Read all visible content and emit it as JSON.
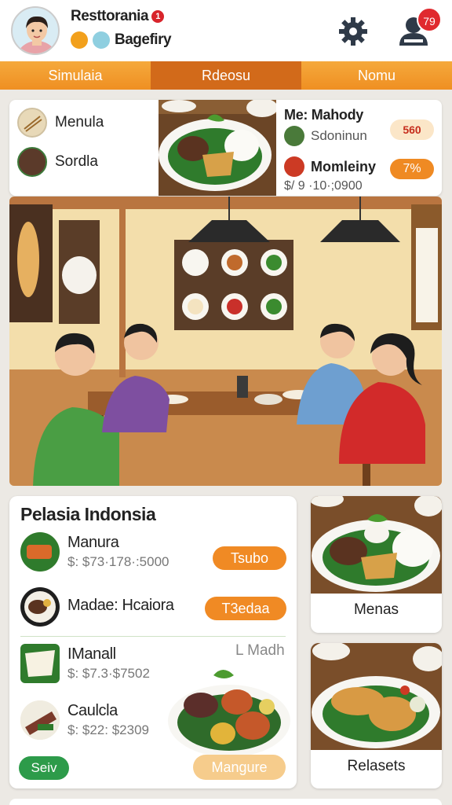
{
  "header": {
    "title": "Resttorania",
    "title_badge": "1",
    "subtitle": "Bagefiry",
    "notification_count": "79"
  },
  "tabs": [
    {
      "label": "Simulaia",
      "active": false
    },
    {
      "label": "Rdeosu",
      "active": true
    },
    {
      "label": "Nomu",
      "active": false
    }
  ],
  "top_card": {
    "menu_items": [
      {
        "label": "Menula",
        "icon": "chopsticks-icon"
      },
      {
        "label": "Sordla",
        "icon": "dish-icon"
      }
    ],
    "info": {
      "title": "Me: Mahody",
      "row1_text": "Sdoninun",
      "row2_text": "Momleiny",
      "price_badge": "560",
      "discount_badge": "7%",
      "hours": "$/ 9 ·10·;0900"
    }
  },
  "list_card": {
    "title": "Pelasia Indonsia",
    "items": [
      {
        "name": "Manura",
        "price": "$: $73·178·:5000",
        "button": "Tsubo"
      },
      {
        "name": "Madae: Hcaiora",
        "price": "",
        "button": "T3edaa"
      },
      {
        "name": "IManall",
        "price": "$: $7.3·$7502",
        "button": ""
      },
      {
        "name": "Caulcla",
        "price": "$: $22: $2309",
        "button": ""
      }
    ],
    "right_note": "L Madh",
    "green_button": "Seiv",
    "manage_button": "Mangure"
  },
  "side_cards": [
    {
      "label": "Menas"
    },
    {
      "label": "Relasets"
    }
  ],
  "colors": {
    "accent_orange": "#ef8f22",
    "active_tab": "#d26a1a",
    "notification_red": "#e02a2f",
    "green_button": "#2d9b4a"
  }
}
